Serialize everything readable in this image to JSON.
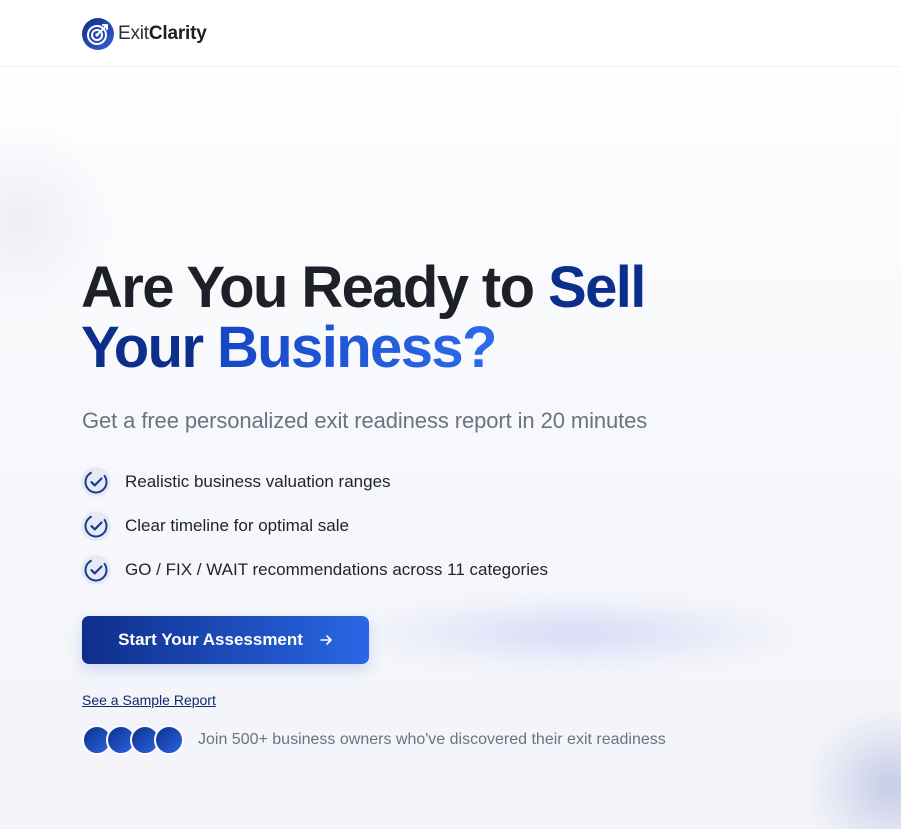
{
  "brand": {
    "name_light": "Exit",
    "name_bold": "Clarity",
    "primary_color": "#0d2f8c",
    "accent_color": "#2a67e6"
  },
  "hero": {
    "headline_part1": "Are You Ready to ",
    "headline_accent1": "Sell",
    "headline_accent2": "Your",
    "headline_accent3": "Business?",
    "subtitle": "Get a free personalized exit readiness report in 20 minutes"
  },
  "features": [
    {
      "icon": "check-circle-icon",
      "text": "Realistic business valuation ranges"
    },
    {
      "icon": "check-circle-icon",
      "text": "Clear timeline for optimal sale"
    },
    {
      "icon": "check-circle-icon",
      "text": "GO / FIX / WAIT recommendations across 11 categories"
    }
  ],
  "cta": {
    "label": "Start Your Assessment",
    "icon": "arrow-right-icon"
  },
  "sample_link": "See a Sample Report",
  "social_proof": {
    "avatar_count": 4,
    "text": "Join 500+ business owners who've discovered their exit readiness"
  }
}
